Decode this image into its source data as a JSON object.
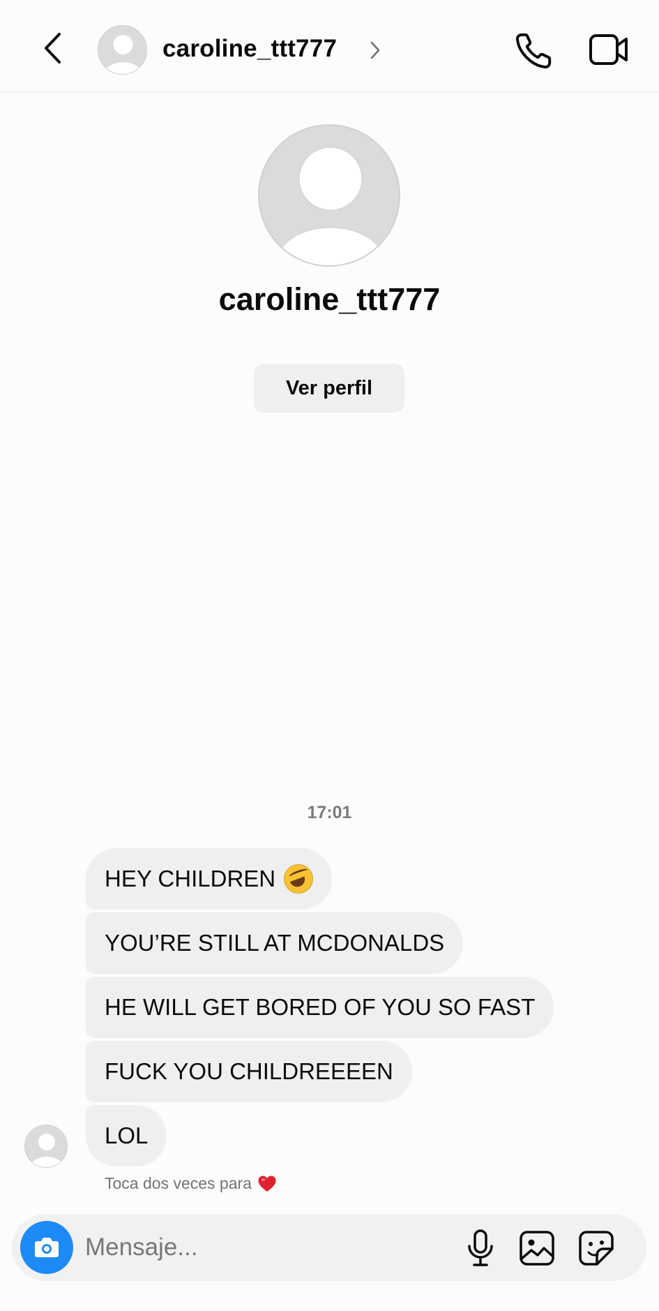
{
  "header": {
    "username": "caroline_ttt777"
  },
  "profile": {
    "username": "caroline_ttt777",
    "view_profile_label": "Ver perfil"
  },
  "thread": {
    "timestamp": "17:01",
    "messages": [
      {
        "text": "HEY CHILDREN",
        "emoji": "rolling-on-floor-laughing"
      },
      {
        "text": "YOU’RE STILL AT MCDONALDS"
      },
      {
        "text": "HE WILL GET BORED OF YOU SO FAST"
      },
      {
        "text": "FUCK YOU CHILDREEEEN"
      },
      {
        "text": "LOL"
      }
    ],
    "hint": "Toca dos veces para",
    "hint_icon": "red-heart"
  },
  "composer": {
    "placeholder": "Mensaje..."
  },
  "colors": {
    "accent": "#1e8af7",
    "bubble": "#efeff1",
    "heart": "#e0202f"
  }
}
